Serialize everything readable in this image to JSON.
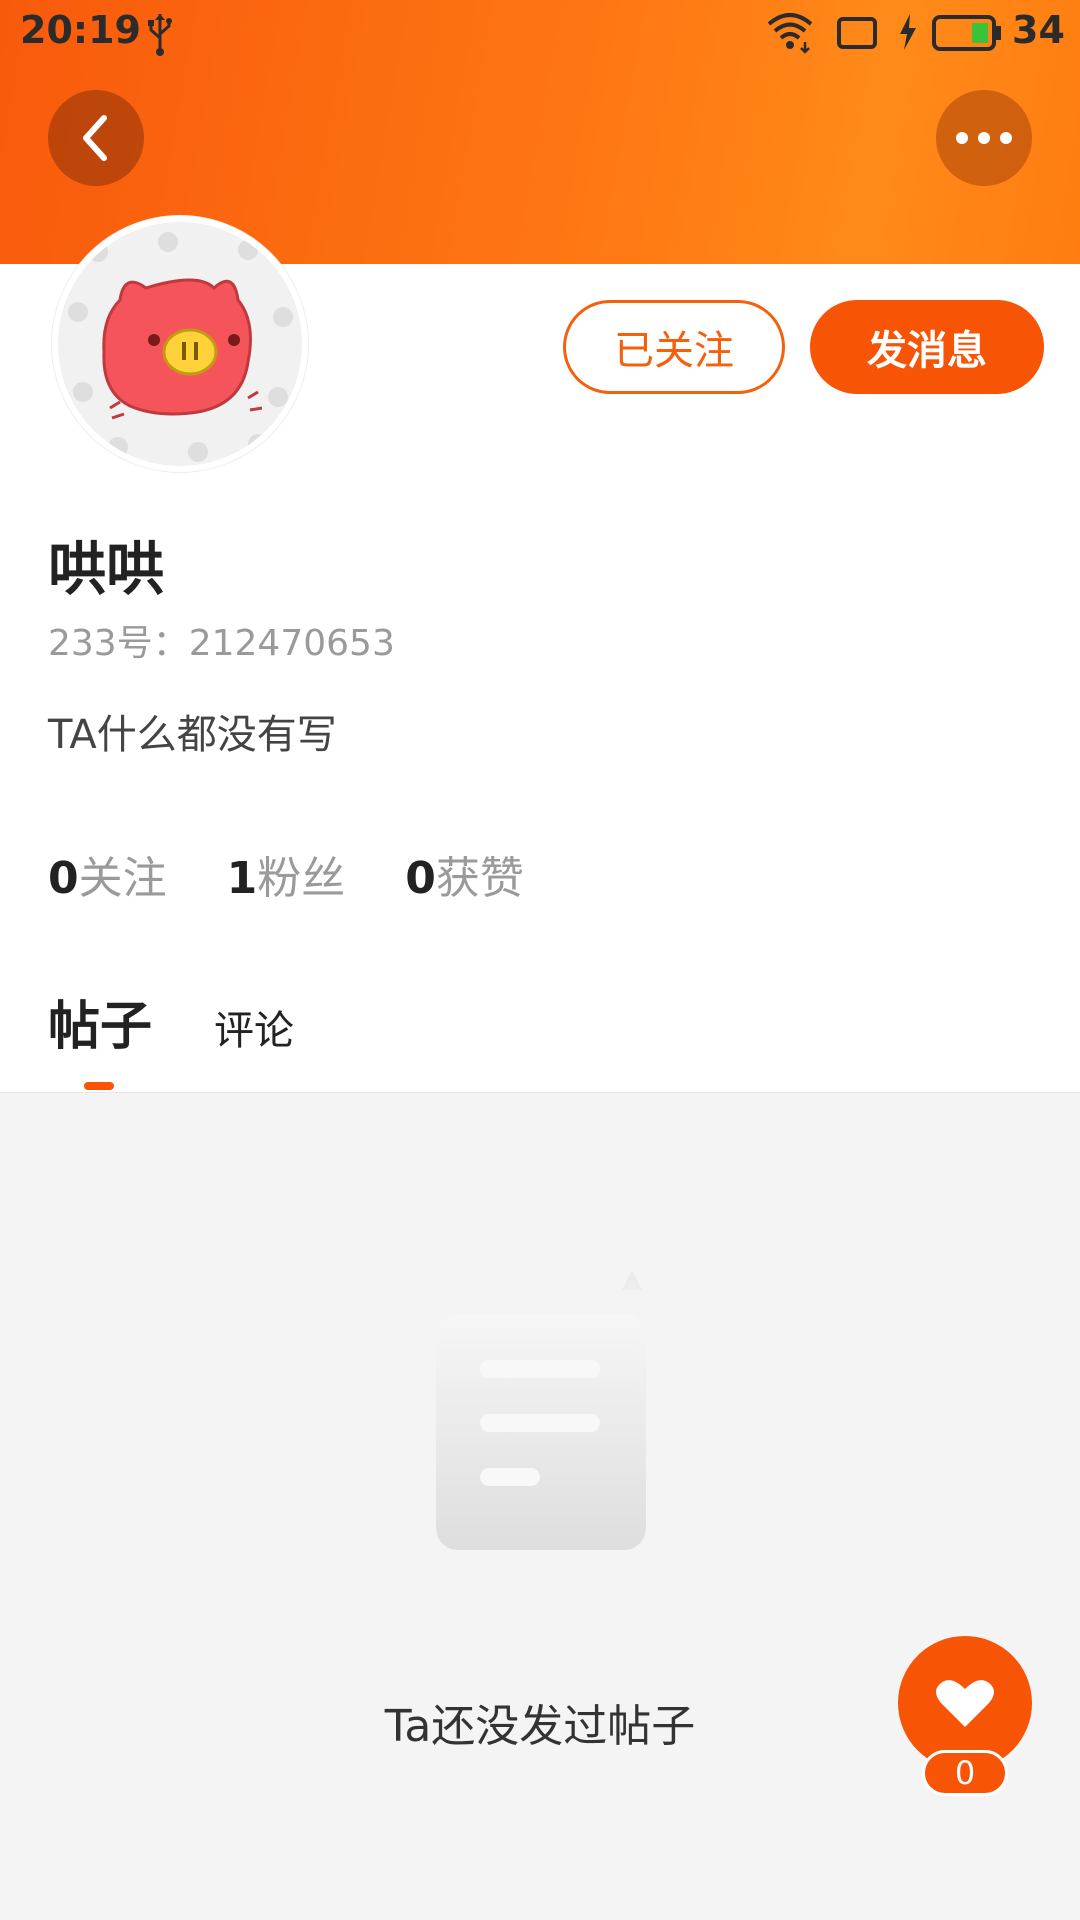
{
  "status_bar": {
    "time": "20:19",
    "battery": "34"
  },
  "header": {
    "back_icon": "back-arrow-icon",
    "more_icon": "more-dots-icon"
  },
  "profile": {
    "name": "哄哄",
    "id_text": "233号：212470653",
    "bio": "TA什么都没有写",
    "follow_button": "已关注",
    "message_button": "发消息",
    "stats": [
      {
        "num": "0",
        "label": "关注"
      },
      {
        "num": "1",
        "label": "粉丝"
      },
      {
        "num": "0",
        "label": "获赞"
      }
    ]
  },
  "tabs": [
    {
      "label": "帖子",
      "active": true
    },
    {
      "label": "评论",
      "active": false
    }
  ],
  "empty_state": {
    "text": "Ta还没发过帖子"
  },
  "like": {
    "count": "0"
  },
  "colors": {
    "accent": "#f85406",
    "header_gradient_start": "#f85a0c",
    "header_gradient_end": "#ff8a1a"
  }
}
